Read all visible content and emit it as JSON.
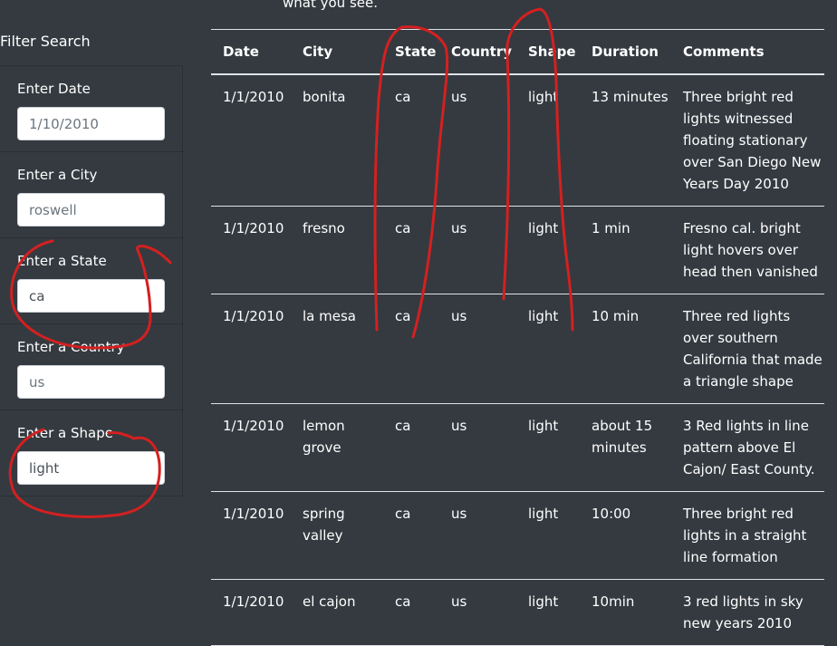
{
  "intro": {
    "tail": "what you see."
  },
  "filter": {
    "title": "Filter Search",
    "fields": [
      {
        "label": "Enter Date",
        "placeholder": "1/10/2010",
        "value": ""
      },
      {
        "label": "Enter a City",
        "placeholder": "roswell",
        "value": ""
      },
      {
        "label": "Enter a State",
        "placeholder": "",
        "value": "ca"
      },
      {
        "label": "Enter a Country",
        "placeholder": "us",
        "value": ""
      },
      {
        "label": "Enter a Shape",
        "placeholder": "",
        "value": "light"
      }
    ]
  },
  "table": {
    "headers": [
      "Date",
      "City",
      "State",
      "Country",
      "Shape",
      "Duration",
      "Comments"
    ],
    "rows": [
      [
        "1/1/2010",
        "bonita",
        "ca",
        "us",
        "light",
        "13 minutes",
        "Three bright red lights witnessed floating stationary over San Diego New Years Day 2010"
      ],
      [
        "1/1/2010",
        "fresno",
        "ca",
        "us",
        "light",
        "1 min",
        "Fresno cal. bright light hovers over head then vanished"
      ],
      [
        "1/1/2010",
        "la mesa",
        "ca",
        "us",
        "light",
        "10 min",
        "Three red lights over southern California that made a triangle shape"
      ],
      [
        "1/1/2010",
        "lemon grove",
        "ca",
        "us",
        "light",
        "about 15 minutes",
        "3 Red lights in line pattern above El Cajon/ East County."
      ],
      [
        "1/1/2010",
        "spring valley",
        "ca",
        "us",
        "light",
        "10:00",
        "Three bright red lights in a straight line formation"
      ],
      [
        "1/1/2010",
        "el cajon",
        "ca",
        "us",
        "light",
        "10min",
        "3 red lights in sky new years 2010"
      ]
    ]
  },
  "annotation_color": "#d42020"
}
